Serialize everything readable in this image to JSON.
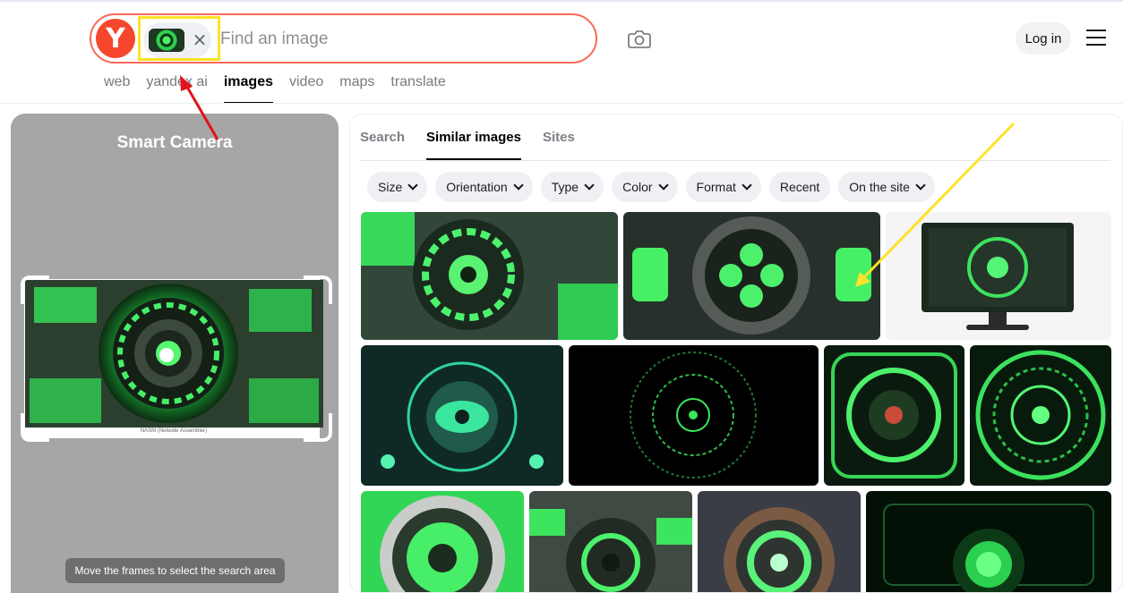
{
  "header": {
    "logo_letter": "Y",
    "search_placeholder": "Find an image",
    "chip_close": "×",
    "login_label": "Log in"
  },
  "services": [
    "web",
    "yandex ai",
    "images",
    "video",
    "maps",
    "translate"
  ],
  "smart_camera": {
    "title": "Smart Camera",
    "preview_caption": "NASM (Netwide Assembler)",
    "hint": "Move the frames to select the search area"
  },
  "results": {
    "tabs": [
      "Search",
      "Similar images",
      "Sites"
    ],
    "filters": [
      "Size",
      "Orientation",
      "Type",
      "Color",
      "Format",
      "Recent",
      "On the site"
    ],
    "filter_has_dropdown": [
      true,
      true,
      true,
      true,
      true,
      false,
      true
    ],
    "image_count": 11
  },
  "colors": {
    "brand_red": "#f5472d",
    "search_border": "#f66a57",
    "highlight_yellow": "#ffe227",
    "annotation_red": "#e0141a",
    "tech_green": "#3ae65c"
  }
}
